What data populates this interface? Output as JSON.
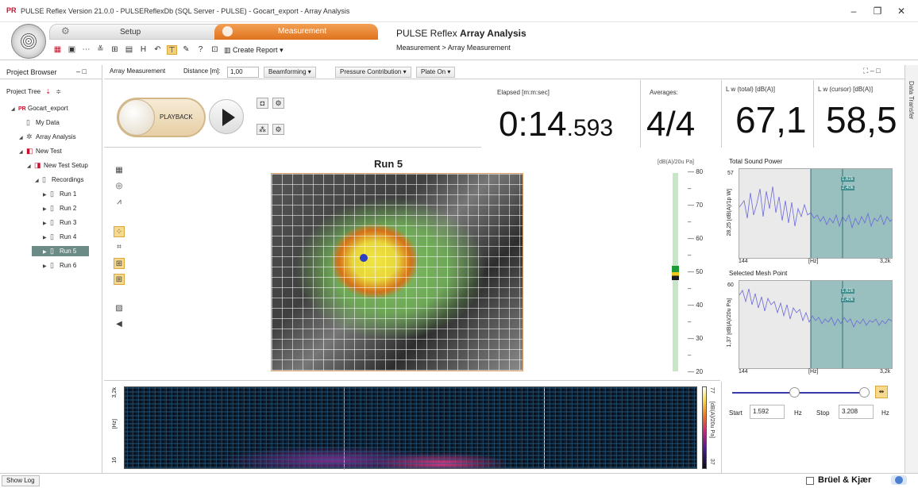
{
  "window": {
    "app_icon": "PR",
    "title": "PULSE Reflex Version 21.0.0 - PULSEReflexDb (SQL Server - PULSE) - Gocart_export - Array Analysis",
    "minimize": "–",
    "maximize": "❐",
    "close": "✕"
  },
  "ribbon": {
    "setup_tab": "Setup",
    "measurement_tab": "Measurement",
    "create_report": "Create Report",
    "app_name": "PULSE Reflex",
    "module_name": "Array Analysis",
    "breadcrumb": "Measurement > Array Measurement"
  },
  "project_browser": {
    "title": "Project Browser",
    "tree_label": "Project Tree",
    "items": [
      {
        "label": "Gocart_export",
        "level": 0,
        "icon": "PR"
      },
      {
        "label": "My Data",
        "level": 1,
        "icon": "doc"
      },
      {
        "label": "Array Analysis",
        "level": 1,
        "icon": "array"
      },
      {
        "label": "New Test",
        "level": 1,
        "icon": "test"
      },
      {
        "label": "New Test Setup",
        "level": 2,
        "icon": "setup"
      },
      {
        "label": "Recordings",
        "level": 3,
        "icon": "doc"
      },
      {
        "label": "Run 1",
        "level": 4,
        "icon": "doc"
      },
      {
        "label": "Run 2",
        "level": 4,
        "icon": "doc"
      },
      {
        "label": "Run 3",
        "level": 4,
        "icon": "doc"
      },
      {
        "label": "Run 4",
        "level": 4,
        "icon": "doc"
      },
      {
        "label": "Run 5",
        "level": 4,
        "icon": "doc",
        "selected": true
      },
      {
        "label": "Run 6",
        "level": 4,
        "icon": "doc"
      }
    ]
  },
  "subbar": {
    "tab": "Array Measurement",
    "distance_label": "Distance [m]:",
    "distance_value": "1,00",
    "beamforming": "Beamforming",
    "pressure_contribution": "Pressure Contribution",
    "plate_on": "Plate On",
    "side_tab": "Data Transfer"
  },
  "playback": {
    "label": "PLAYBACK"
  },
  "stats": {
    "elapsed_label": "Elapsed [m:m:sec]",
    "elapsed_main": "0:14",
    "elapsed_ms": ".593",
    "averages_label": "Averages:",
    "averages_value": "4/4",
    "lw_total_label": "L w (total) [dB(A)]",
    "lw_total_value": "67,1",
    "lw_cursor_label": "L w (cursor) [dB(A)]",
    "lw_cursor_value": "58,5"
  },
  "image_view": {
    "title": "Run 5",
    "color_unit": "[dB(A)/20u Pa]",
    "ticks": [
      "80",
      "70",
      "60",
      "50",
      "40",
      "30",
      "20"
    ]
  },
  "total_sound_power": {
    "title": "Total Sound Power",
    "ylabel": "28,25 [dB(A)/1p W]",
    "ytop": "57",
    "x_start": "144",
    "x_unit": "[Hz]",
    "x_end": "3,2k",
    "marker1": "1,62k",
    "marker2": "2,40k"
  },
  "mesh_point": {
    "title": "Selected Mesh Point",
    "ylabel": "1,37 [dB(A)/20u Pa]",
    "ytop": "60",
    "x_start": "144",
    "x_unit": "[Hz]",
    "x_end": "3,2k",
    "marker1": "1,62k",
    "marker2": "2,40k"
  },
  "spectrogram": {
    "y_top": "3,2k",
    "y_unit": "[Hz]",
    "y_bottom": "16",
    "cbar_top": "77",
    "cbar_unit": "[dB(A)/20u Pa]",
    "cbar_bottom": "37"
  },
  "range": {
    "start_label": "Start",
    "start_value": "1.592",
    "start_unit": "Hz",
    "stop_label": "Stop",
    "stop_value": "3.208",
    "stop_unit": "Hz"
  },
  "status": {
    "show_log": "Show Log",
    "brand": "Brüel & Kjær"
  }
}
